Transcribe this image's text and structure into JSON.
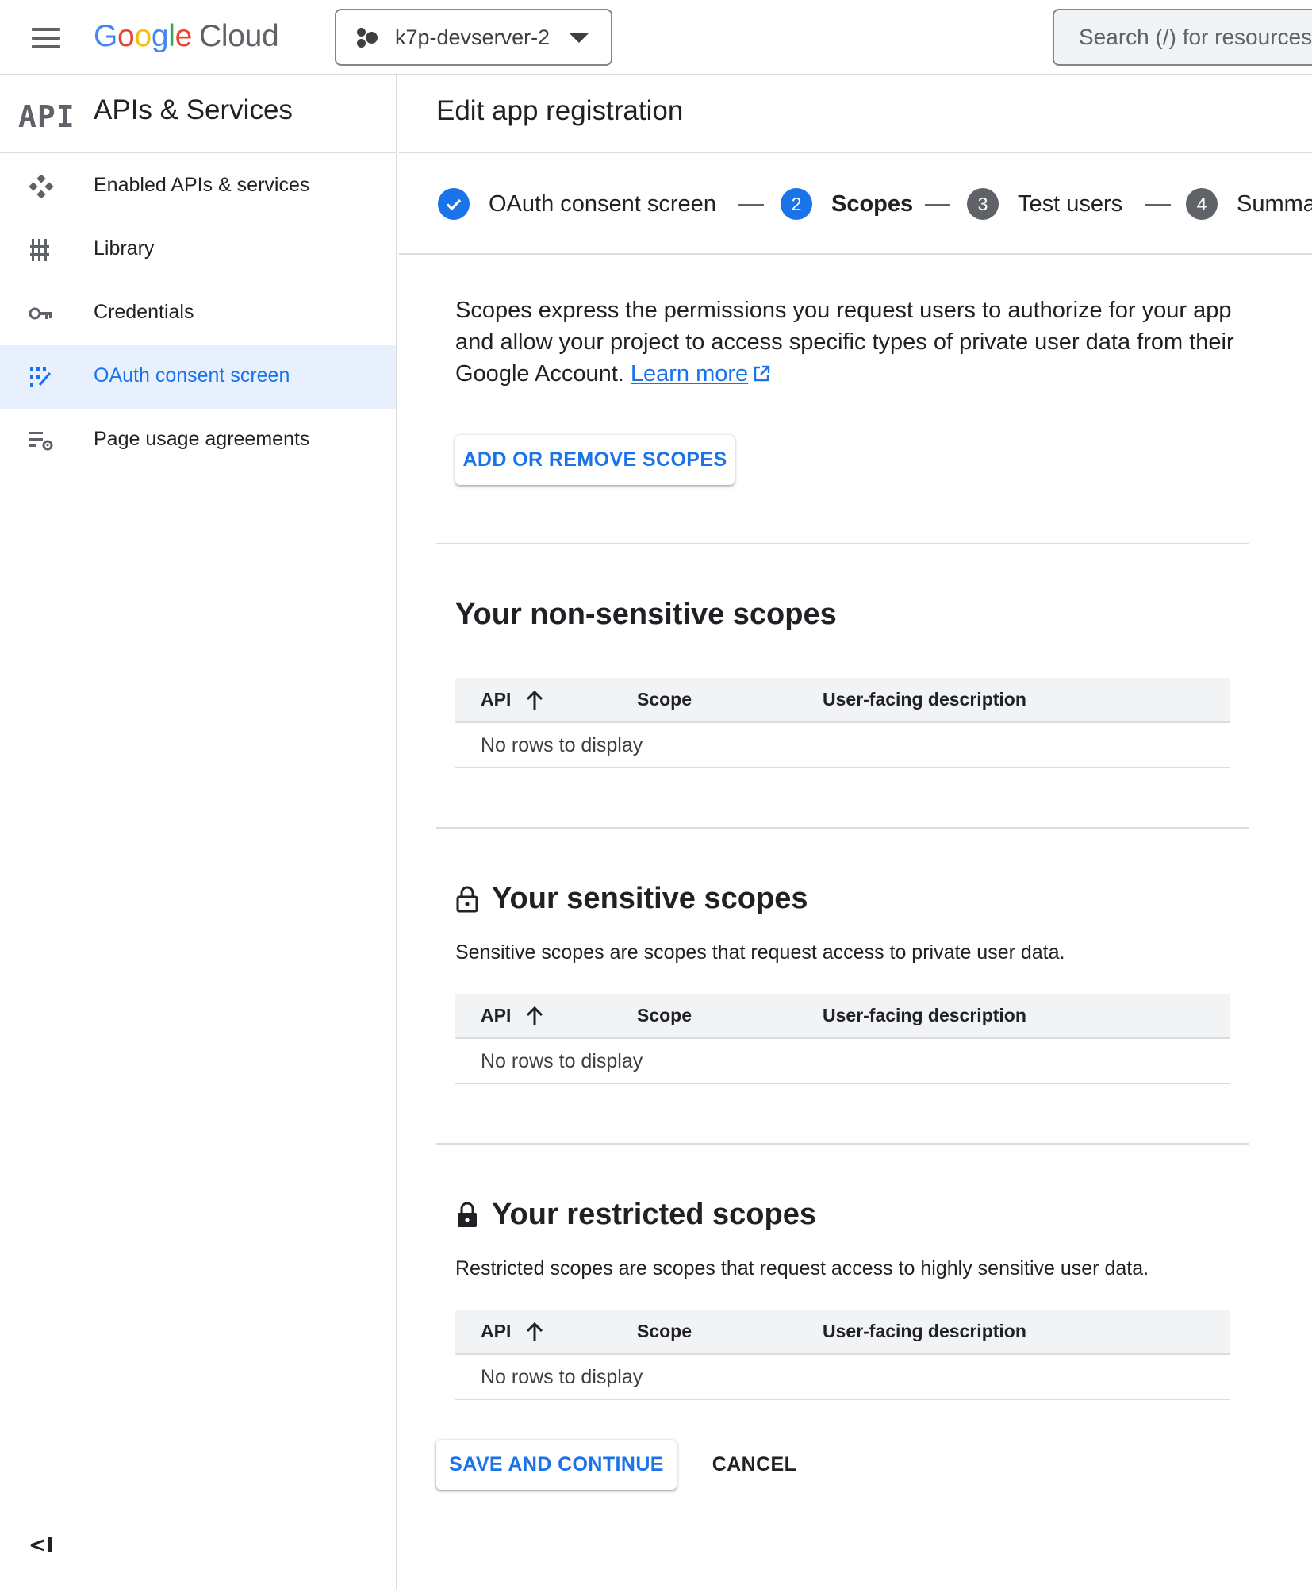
{
  "topbar": {
    "logo": {
      "g1": "G",
      "o1": "o",
      "o2": "o",
      "g2": "g",
      "l": "l",
      "e": "e",
      "product": "Cloud"
    },
    "project": "k7p-devserver-2",
    "search_placeholder": "Search (/) for resources"
  },
  "sidebar": {
    "logo_text": "API",
    "title": "APIs & Services",
    "items": [
      {
        "label": "Enabled APIs & services",
        "icon": "enabled-apis-icon"
      },
      {
        "label": "Library",
        "icon": "library-icon"
      },
      {
        "label": "Credentials",
        "icon": "key-icon"
      },
      {
        "label": "OAuth consent screen",
        "icon": "oauth-icon",
        "active": true
      },
      {
        "label": "Page usage agreements",
        "icon": "settings-list-icon"
      }
    ],
    "collapse_glyph": "<I"
  },
  "main": {
    "title": "Edit app registration",
    "steps": [
      {
        "label": "OAuth consent screen",
        "state": "done"
      },
      {
        "number": "2",
        "label": "Scopes",
        "state": "current"
      },
      {
        "number": "3",
        "label": "Test users",
        "state": "pending"
      },
      {
        "number": "4",
        "label": "Summary",
        "state": "pending"
      }
    ],
    "intro_text": "Scopes express the permissions you request users to authorize for your app and allow your project to access specific types of private user data from their Google Account.",
    "learn_more": "Learn more",
    "add_scopes_button": "ADD OR REMOVE SCOPES",
    "sections": {
      "non_sensitive": {
        "title": "Your non-sensitive scopes"
      },
      "sensitive": {
        "title": "Your sensitive scopes",
        "description": "Sensitive scopes are scopes that request access to private user data."
      },
      "restricted": {
        "title": "Your restricted scopes",
        "description": "Restricted scopes are scopes that request access to highly sensitive user data."
      }
    },
    "table": {
      "columns": [
        "API",
        "Scope",
        "User-facing description"
      ],
      "empty": "No rows to display"
    },
    "save_button": "SAVE AND CONTINUE",
    "cancel_button": "CANCEL"
  },
  "colors": {
    "accent": "#1a73e8",
    "active_nav_bg": "#e8f0fe",
    "step_pending": "#5f6368",
    "divider": "#dadce0"
  }
}
